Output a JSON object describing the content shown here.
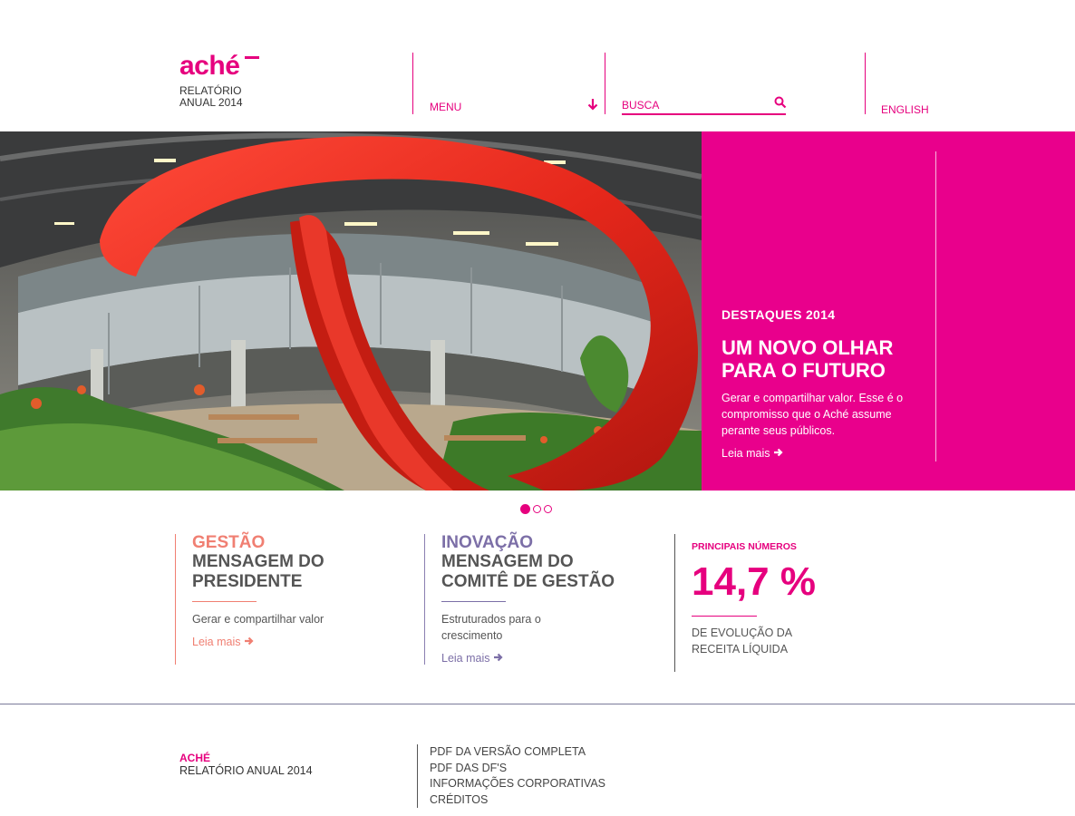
{
  "header": {
    "logo_text": "aché",
    "logo_subtitle_line1": "RELATÓRIO",
    "logo_subtitle_line2": "ANUAL 2014",
    "menu_label": "MENU",
    "search_placeholder": "BUSCA",
    "language_link": "ENGLISH"
  },
  "hero": {
    "kicker": "DESTAQUES 2014",
    "title_line1": "UM NOVO OLHAR",
    "title_line2": "PARA O FUTURO",
    "text": "Gerar e compartilhar valor. Esse é o compromisso que o Aché assume perante seus públicos.",
    "link": "Leia mais",
    "panel_color": "#e9008c"
  },
  "carousel": {
    "total_slides": 3,
    "active_index": 0
  },
  "columns": [
    {
      "kicker": "GESTÃO",
      "headline_line1": "MENSAGEM DO",
      "headline_line2": "PRESIDENTE",
      "description": "Gerar e compartilhar valor",
      "link": "Leia mais",
      "accent": "#f07f72"
    },
    {
      "kicker": "INOVAÇÃO",
      "headline_line1": "MENSAGEM DO",
      "headline_line2": "COMITÊ DE GESTÃO",
      "description": "Estruturados para o crescimento",
      "link": "Leia mais",
      "accent": "#7c6fa7"
    }
  ],
  "highlight": {
    "kicker": "PRINCIPAIS NÚMEROS",
    "value": "14,7 %",
    "description": "DE EVOLUÇÃO DA RECEITA LÍQUIDA"
  },
  "footer": {
    "brand": "ACHÉ",
    "subtitle": "RELATÓRIO ANUAL 2014",
    "links": [
      "PDF DA VERSÃO COMPLETA",
      "PDF DAS DF'S",
      "INFORMAÇÕES CORPORATIVAS",
      "CRÉDITOS"
    ]
  },
  "colors": {
    "brand": "#e6007e"
  }
}
